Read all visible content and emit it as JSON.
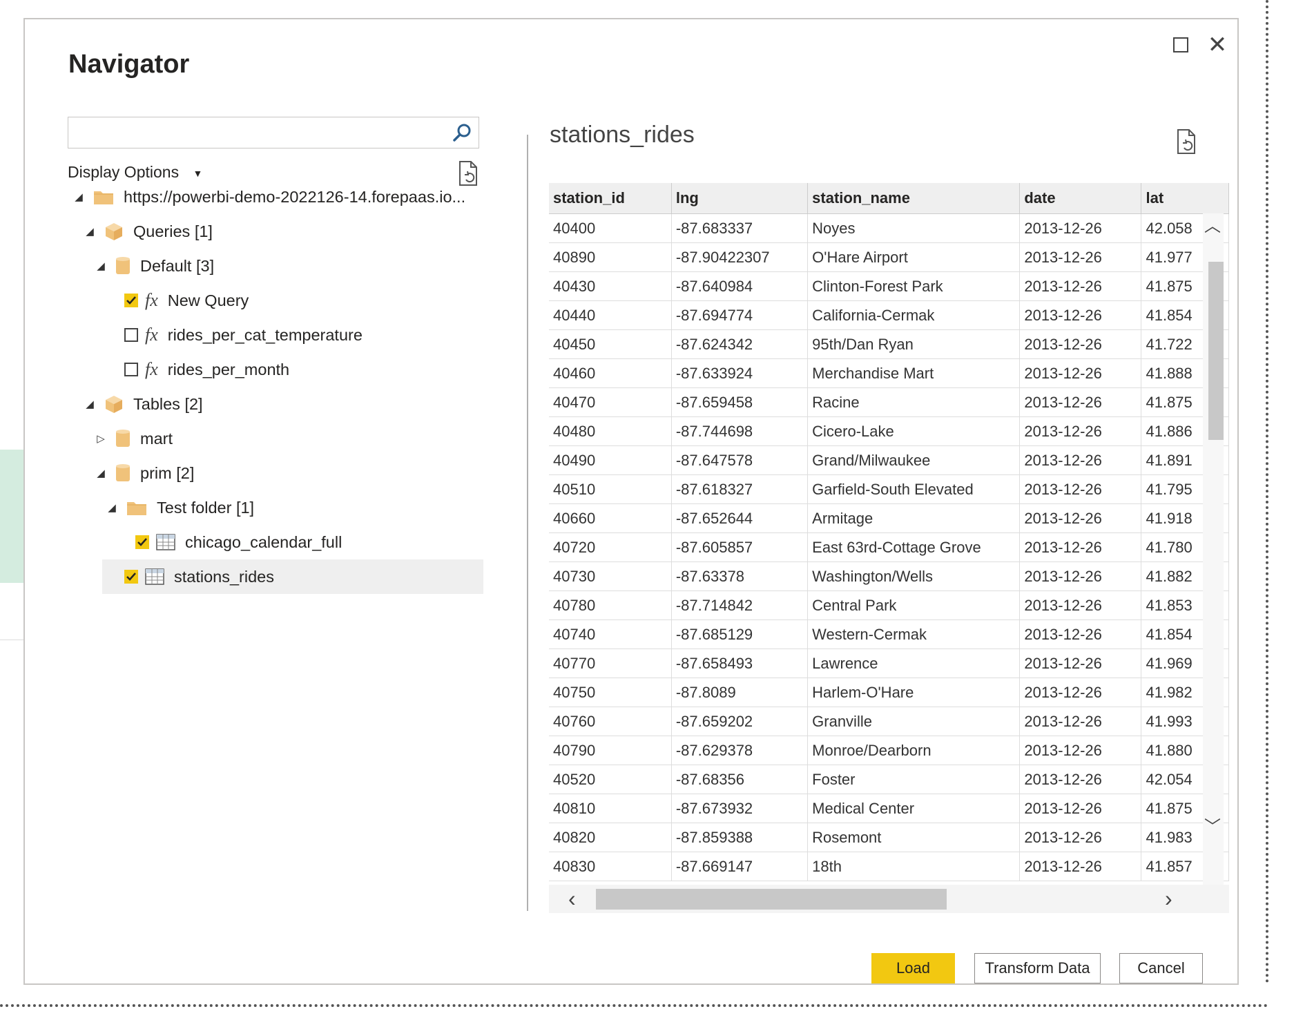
{
  "dialog": {
    "title": "Navigator"
  },
  "search": {
    "placeholder": "",
    "value": ""
  },
  "display_options": {
    "label": "Display Options"
  },
  "tree": {
    "root": "https://powerbi-demo-2022126-14.forepaas.io...",
    "queries": "Queries [1]",
    "default": "Default [3]",
    "new_query": "New Query",
    "rides_per_cat": "rides_per_cat_temperature",
    "rides_per_month": "rides_per_month",
    "tables": "Tables [2]",
    "mart": "mart",
    "prim": "prim [2]",
    "test_folder": "Test folder [1]",
    "chicago_calendar": "chicago_calendar_full",
    "stations_rides": "stations_rides"
  },
  "checks": {
    "new_query": true,
    "rides_per_cat": false,
    "rides_per_month": false,
    "chicago_calendar": true,
    "stations_rides": true
  },
  "preview": {
    "title": "stations_rides",
    "columns": [
      "station_id",
      "lng",
      "station_name",
      "date",
      "lat"
    ],
    "rows": [
      [
        "40400",
        "-87.683337",
        "Noyes",
        "2013-12-26",
        "42.058"
      ],
      [
        "40890",
        "-87.90422307",
        "O'Hare Airport",
        "2013-12-26",
        "41.977"
      ],
      [
        "40430",
        "-87.640984",
        "Clinton-Forest Park",
        "2013-12-26",
        "41.875"
      ],
      [
        "40440",
        "-87.694774",
        "California-Cermak",
        "2013-12-26",
        "41.854"
      ],
      [
        "40450",
        "-87.624342",
        "95th/Dan Ryan",
        "2013-12-26",
        "41.722"
      ],
      [
        "40460",
        "-87.633924",
        "Merchandise Mart",
        "2013-12-26",
        "41.888"
      ],
      [
        "40470",
        "-87.659458",
        "Racine",
        "2013-12-26",
        "41.875"
      ],
      [
        "40480",
        "-87.744698",
        "Cicero-Lake",
        "2013-12-26",
        "41.886"
      ],
      [
        "40490",
        "-87.647578",
        "Grand/Milwaukee",
        "2013-12-26",
        "41.891"
      ],
      [
        "40510",
        "-87.618327",
        "Garfield-South Elevated",
        "2013-12-26",
        "41.795"
      ],
      [
        "40660",
        "-87.652644",
        "Armitage",
        "2013-12-26",
        "41.918"
      ],
      [
        "40720",
        "-87.605857",
        "East 63rd-Cottage Grove",
        "2013-12-26",
        "41.780"
      ],
      [
        "40730",
        "-87.63378",
        "Washington/Wells",
        "2013-12-26",
        "41.882"
      ],
      [
        "40780",
        "-87.714842",
        "Central Park",
        "2013-12-26",
        "41.853"
      ],
      [
        "40740",
        "-87.685129",
        "Western-Cermak",
        "2013-12-26",
        "41.854"
      ],
      [
        "40770",
        "-87.658493",
        "Lawrence",
        "2013-12-26",
        "41.969"
      ],
      [
        "40750",
        "-87.8089",
        "Harlem-O'Hare",
        "2013-12-26",
        "41.982"
      ],
      [
        "40760",
        "-87.659202",
        "Granville",
        "2013-12-26",
        "41.993"
      ],
      [
        "40790",
        "-87.629378",
        "Monroe/Dearborn",
        "2013-12-26",
        "41.880"
      ],
      [
        "40520",
        "-87.68356",
        "Foster",
        "2013-12-26",
        "42.054"
      ],
      [
        "40810",
        "-87.673932",
        "Medical Center",
        "2013-12-26",
        "41.875"
      ],
      [
        "40820",
        "-87.859388",
        "Rosemont",
        "2013-12-26",
        "41.983"
      ],
      [
        "40830",
        "-87.669147",
        "18th",
        "2013-12-26",
        "41.857"
      ]
    ]
  },
  "buttons": {
    "load": "Load",
    "transform": "Transform Data",
    "cancel": "Cancel"
  },
  "colors": {
    "accent": "#f2c811",
    "folder": "#f0c27a",
    "selection": "#efefef"
  }
}
